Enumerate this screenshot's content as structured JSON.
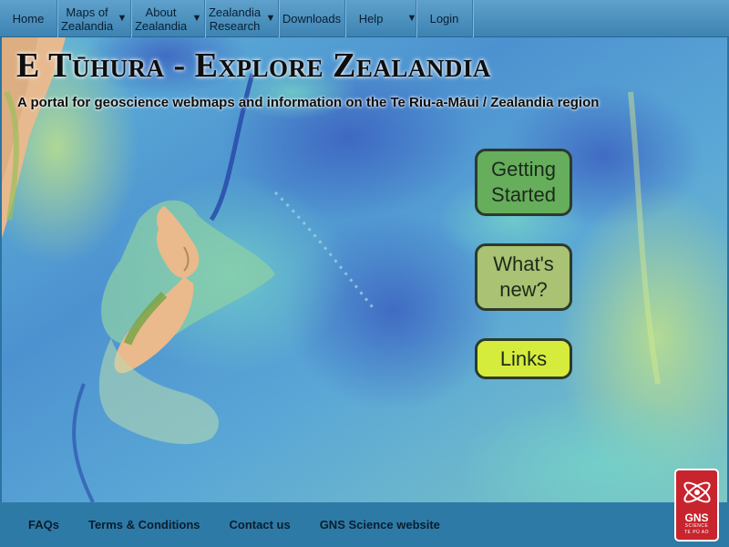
{
  "nav": {
    "home": "Home",
    "maps": "Maps of Zealandia",
    "about": "About Zealandia",
    "research": "Zealandia Research",
    "downloads": "Downloads",
    "help": "Help",
    "login": "Login",
    "caret": "▼"
  },
  "hero": {
    "title": "E Tūhura - Explore Zealandia",
    "subtitle": "A portal for geoscience webmaps and information on the Te Riu-a-Māui / Zealandia region"
  },
  "buttons": {
    "getting_started": "Getting Started",
    "whats_new": "What's new?",
    "links": "Links"
  },
  "footer": {
    "icon": "",
    "faqs": "FAQs",
    "terms": "Terms & Conditions",
    "contact": "Contact us",
    "gns": "GNS Science website"
  },
  "logo": {
    "word": "GNS",
    "sub": "SCIENCE",
    "motto": "TE PŪ AO"
  },
  "colors": {
    "nav_bg": "#4a90c0",
    "footer_bg": "#2e7aa6",
    "getting_started_bg": "#66ad5c",
    "whats_new_bg": "#a9c273",
    "links_bg": "#d6ec3c",
    "logo_bg": "#c8242e"
  }
}
